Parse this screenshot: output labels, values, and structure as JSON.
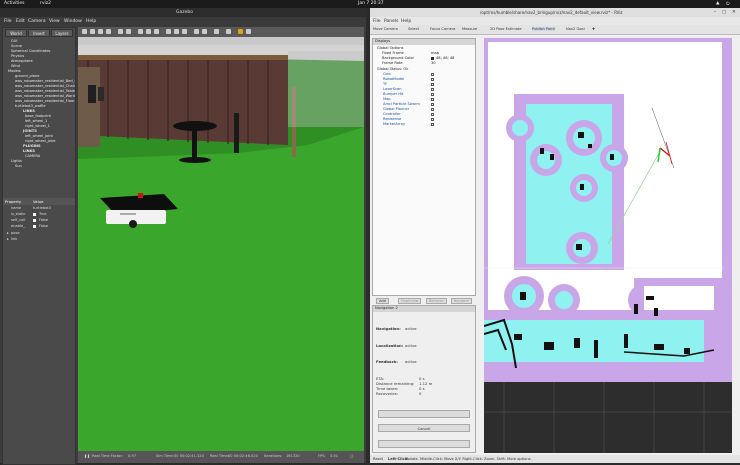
{
  "topbar": {
    "activities": "Activities",
    "app": "rviz2",
    "clock": "Jan 7  20:37"
  },
  "gazebo": {
    "title": "Gazebo",
    "menu": [
      "File",
      "Edit",
      "Camera",
      "View",
      "Window",
      "Help"
    ],
    "tabs": [
      "World",
      "Insert",
      "Layers"
    ],
    "tree": [
      "GUI",
      "Scene",
      "Spherical Coordinates",
      "Physics",
      "Atmosphere",
      "Wind",
      "Models",
      "ground_plane",
      "aws_robomaker_residential_Bed_01",
      "aws_robomaker_residential_Chair_01",
      "aws_robomaker_residential_Table_01",
      "aws_robomaker_residential_Wardrobe_01",
      "aws_robomaker_residential_Floor_01",
      "turtlebot3_waffle",
      "LINKS",
      "base_footprint",
      "left_wheel_1",
      "right_wheel_1",
      "JOINTS",
      "left_wheel_joint",
      "right_wheel_joint",
      "PLUGINS",
      "LINKS",
      "CAMERA",
      "Lights",
      "Sun"
    ],
    "properties": {
      "header": [
        "Property",
        "Value"
      ],
      "rows": [
        [
          "name",
          "turtlebot3"
        ],
        [
          "is_static",
          "True"
        ],
        [
          "self_coll",
          "False"
        ],
        [
          "enable_",
          "False"
        ]
      ]
    },
    "tree_extra": [
      "pose",
      "link"
    ],
    "status": [
      "Real Time Factor:",
      "0.97",
      "Sim Time:",
      "00 00:02:41.320",
      "Real Time:",
      "00 00:02:46.020",
      "Iterations:",
      "161320",
      "FPS:",
      "3.51"
    ]
  },
  "rviz": {
    "title": "/opt/ros/humble/share/nav2_bringup/rviz/nav2_default_view.rviz* - RViz",
    "menu": [
      "File",
      "Panels",
      "Help"
    ],
    "tools": [
      "Move Camera",
      "Select",
      "Focus Camera",
      "Measure",
      "2D Pose Estimate",
      "Publish Point",
      "Nav2 Goal"
    ],
    "displays_header": "Displays",
    "global_options": "Global Options",
    "fixed_frame": [
      "Fixed Frame",
      "map"
    ],
    "bg_color": [
      "Background Color",
      "48; 48; 48"
    ],
    "frame_rate": [
      "Frame Rate",
      "30"
    ],
    "global_status": "Global Status: Ok",
    "displays": [
      "Grid",
      "RobotModel",
      "TF",
      "LaserScan",
      "Bumper Hit",
      "Map",
      "Amcl Particle Swarm",
      "Global Planner",
      "Controller",
      "Realsense",
      "MarkerArray"
    ],
    "buttons": [
      "Add",
      "Duplicate",
      "Remove",
      "Rename"
    ],
    "nav": {
      "header": "Navigation 2",
      "navigation": [
        "Navigation:",
        "active"
      ],
      "localization": [
        "Localization:",
        "active"
      ],
      "feedback": [
        "Feedback:",
        "active"
      ],
      "eta": [
        "ETA:",
        "0 s"
      ],
      "distance": [
        "Distance remaining:",
        "1.12 m"
      ],
      "time_taken": [
        "Time taken:",
        "0 s"
      ],
      "recoveries": [
        "Recoveries:",
        "0"
      ],
      "cancel": "Cancel"
    },
    "status": {
      "reset": "Reset",
      "hint_bold": "Left-Click:",
      "hint": "Rotate. Middle-Click: Move X/Y. Right-Click: Zoom. Shift: More options."
    }
  },
  "colors": {
    "gazebo_ground": "#3a9a2a",
    "rviz_map_inflation": "#c9a6e8",
    "rviz_map_cost": "#8ff1f0"
  }
}
